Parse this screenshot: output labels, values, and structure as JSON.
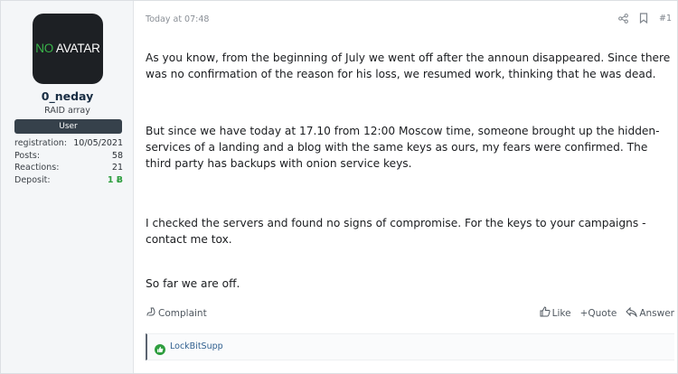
{
  "user": {
    "avatar_no": "NO",
    "avatar_rest": "AVATAR",
    "username": "0_neday",
    "title": "RAID array",
    "banner": "User",
    "stats": [
      {
        "label": "registration:",
        "value": "10/05/2021"
      },
      {
        "label": "Posts:",
        "value": "58"
      },
      {
        "label": "Reactions:",
        "value": "21"
      },
      {
        "label": "Deposit:",
        "value": "1 Ƀ"
      }
    ]
  },
  "post": {
    "date": "Today at 07:48",
    "number": "#1",
    "paragraphs": [
      "As you know, from the beginning of July we went off after the announ disappeared. Since there was no confirmation of the reason for his loss, we resumed work, thinking that he was dead.",
      "But since we have today at 17.10 from 12:00 Moscow time, someone brought up the hidden-services of a landing and a blog with the same keys as ours, my fears were confirmed. The third party has backups with onion service keys.",
      "I checked the servers and found no signs of compromise. For the keys to your campaigns - contact me tox.",
      "So far we are off."
    ]
  },
  "footer": {
    "complaint": "Complaint",
    "like": "Like",
    "quote": "+Quote",
    "answer": "Answer"
  },
  "reactions": {
    "users": "LockBitSupp"
  },
  "colors": {
    "accent_green": "#2e9e3f",
    "banner_bg": "#36414b",
    "link": "#2f5f8f"
  },
  "icons": [
    "share-icon",
    "bookmark-icon",
    "flag-icon",
    "like-icon",
    "reply-icon",
    "like-reaction-icon"
  ]
}
